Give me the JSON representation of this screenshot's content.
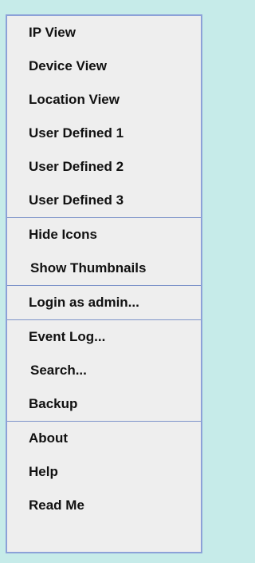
{
  "menu": {
    "groups": [
      {
        "items": [
          {
            "label": "IP View"
          },
          {
            "label": "Device View"
          },
          {
            "label": "Location View"
          },
          {
            "label": "User Defined 1"
          },
          {
            "label": "User Defined 2"
          },
          {
            "label": "User Defined 3"
          }
        ]
      },
      {
        "items": [
          {
            "label": "Hide Icons"
          },
          {
            "label": "Show Thumbnails"
          }
        ]
      },
      {
        "items": [
          {
            "label": "Login as admin..."
          }
        ]
      },
      {
        "items": [
          {
            "label": "Event Log..."
          },
          {
            "label": "Search..."
          },
          {
            "label": "Backup"
          }
        ]
      },
      {
        "items": [
          {
            "label": "About"
          },
          {
            "label": "Help"
          },
          {
            "label": "Read Me"
          }
        ]
      }
    ]
  },
  "colors": {
    "background": "#c6ebe9",
    "menu_background": "#eeeeee",
    "border": "#8ca1d8",
    "text": "#111111"
  }
}
